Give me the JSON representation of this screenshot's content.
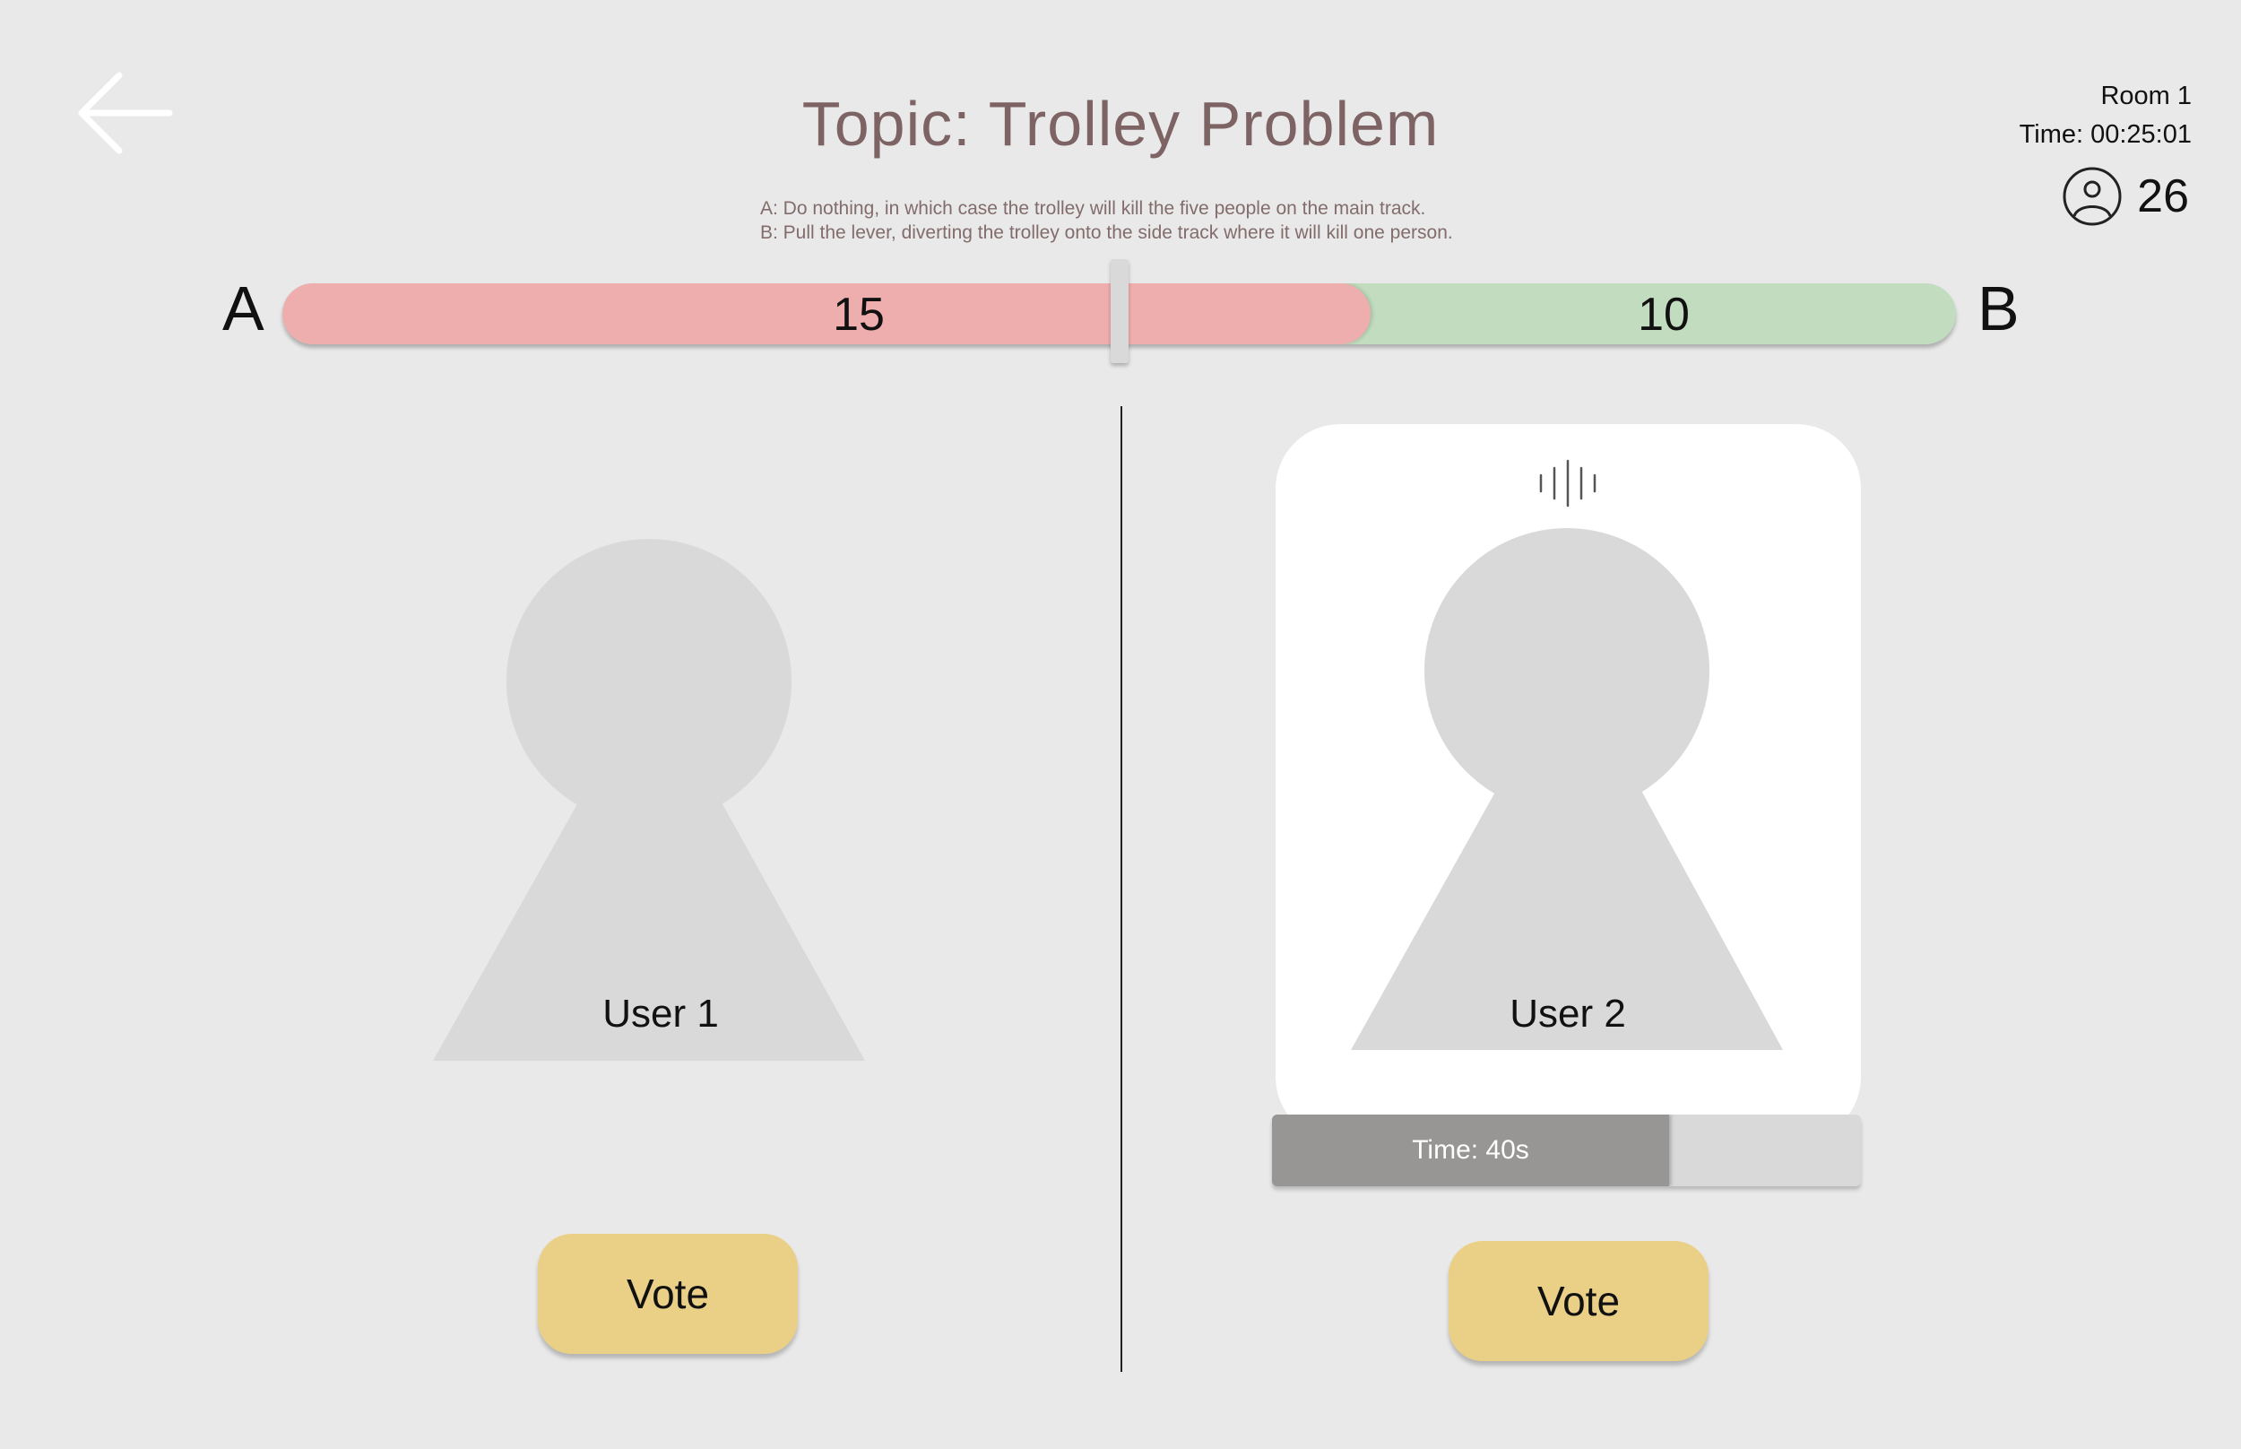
{
  "header": {
    "title": "Topic: Trolley Problem",
    "option_a_text": "A: Do nothing, in which case the trolley will kill the five people on the main track.",
    "option_b_text": "B: Pull the lever, diverting the trolley onto the side track where it will kill one person.",
    "back_icon": "arrow-left-icon"
  },
  "room": {
    "name": "Room 1",
    "time": "Time: 00:25:01",
    "participants": "26",
    "participants_icon": "user-circle-icon"
  },
  "vote_bar": {
    "label_a": "A",
    "label_b": "B",
    "votes_a": "15",
    "votes_b": "10",
    "fraction_a": 0.65,
    "color_a": "#efaeae",
    "color_b": "#c1dcbf"
  },
  "users": [
    {
      "name": "User 1",
      "vote_label": "Vote",
      "speaking": false
    },
    {
      "name": "User 2",
      "vote_label": "Vote",
      "speaking": true,
      "speaking_icon": "audio-wave-icon"
    }
  ],
  "speaker_timer": {
    "text": "Time: 40s",
    "fraction_remaining": 0.675
  },
  "colors": {
    "background": "#e9e9e9",
    "title": "#7d6363",
    "vote_button": "#ead087",
    "avatar": "#d9d9d9"
  }
}
